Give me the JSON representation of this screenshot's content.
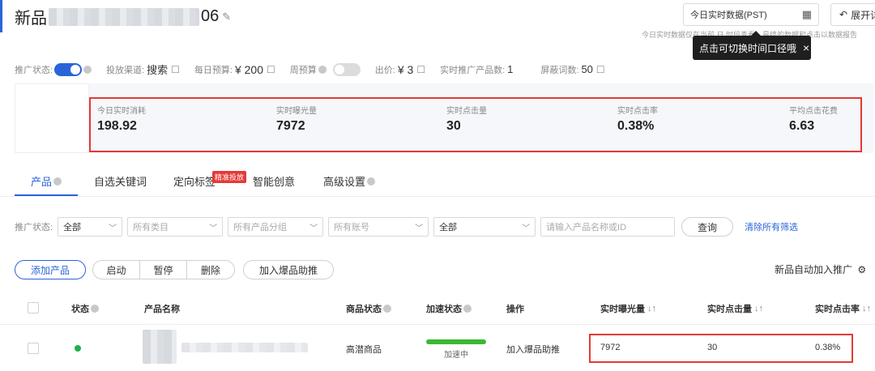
{
  "header": {
    "title_prefix": "新品",
    "title_suffix": "06",
    "date_selector": "今日实时数据(PST)",
    "expand_button": "展开详",
    "note": "今日实时数据仅在当前 日 时段查看，最终的数据和点击以数据报告"
  },
  "tooltip": {
    "text": "点击可切换时间口径哦",
    "close": "×"
  },
  "settings": {
    "status_label": "推广状态:",
    "channel_label": "投放渠道:",
    "channel_value": "搜索",
    "budget_label": "每日预算:",
    "budget_value": "¥ 200",
    "weekly_label": "周预算",
    "bid_label": "出价:",
    "bid_value": "¥ 3",
    "products_label": "实时推广产品数:",
    "products_value": "1",
    "blocked_label": "屏蔽词数:",
    "blocked_value": "50"
  },
  "stats": [
    {
      "label": "今日实时消耗",
      "value": "198.92"
    },
    {
      "label": "实时曝光量",
      "value": "7972"
    },
    {
      "label": "实时点击量",
      "value": "30"
    },
    {
      "label": "实时点击率",
      "value": "0.38%"
    },
    {
      "label": "平均点击花费",
      "value": "6.63"
    }
  ],
  "tabs": [
    {
      "label": "产品"
    },
    {
      "label": "自选关键词"
    },
    {
      "label": "定向标签"
    },
    {
      "label": "智能创意"
    },
    {
      "label": "高级设置"
    }
  ],
  "tab_badge": "精准投放",
  "filters": {
    "status_label": "推广状态:",
    "status_value": "全部",
    "category": "所有类目",
    "group": "所有产品分组",
    "account": "所有账号",
    "all": "全部",
    "search_placeholder": "请输入产品名称或ID",
    "query": "查询",
    "clear": "清除所有筛选"
  },
  "actions": {
    "add": "添加产品",
    "start": "启动",
    "pause": "暂停",
    "delete": "删除",
    "boost": "加入爆品助推",
    "auto_add": "新品自动加入推广",
    "auto_add_icon": "gear-icon"
  },
  "table": {
    "headers": {
      "status": "状态",
      "name": "产品名称",
      "goods_status": "商品状态",
      "speed_status": "加速状态",
      "operation": "操作",
      "impressions": "实时曝光量",
      "clicks": "实时点击量",
      "ctr": "实时点击率"
    },
    "row": {
      "goods_status": "高潜商品",
      "speed_label": "加速中",
      "speed_progress": 1.0,
      "operation": "加入爆品助推",
      "impressions": "7972",
      "clicks": "30",
      "ctr": "0.38%"
    }
  },
  "colors": {
    "accent": "#2b64d8",
    "highlight": "#e53935",
    "success": "#21b04b"
  }
}
